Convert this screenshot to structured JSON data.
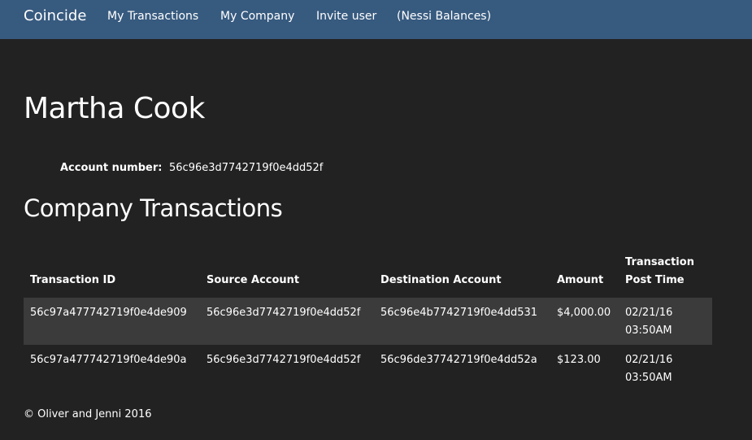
{
  "navbar": {
    "brand": "Coincide",
    "links": [
      "My Transactions",
      "My Company",
      "Invite user",
      "(Nessi Balances)"
    ]
  },
  "page": {
    "title": "Martha Cook",
    "account_label": "Account number:",
    "account_number": "56c96e3d7742719f0e4dd52f",
    "section_title": "Company Transactions"
  },
  "table": {
    "headers": [
      "Transaction ID",
      "Source Account",
      "Destination Account",
      "Amount",
      "Transaction Post Time"
    ],
    "rows": [
      {
        "transaction_id": "56c97a477742719f0e4de909",
        "source": "56c96e3d7742719f0e4dd52f",
        "destination": "56c96e4b7742719f0e4dd531",
        "amount": "$4,000.00",
        "post_time": "02/21/16 03:50AM"
      },
      {
        "transaction_id": "56c97a477742719f0e4de90a",
        "source": "56c96e3d7742719f0e4dd52f",
        "destination": "56c96de37742719f0e4dd52a",
        "amount": "$123.00",
        "post_time": "02/21/16 03:50AM"
      }
    ]
  },
  "footer": {
    "text": "© Oliver and Jenni 2016"
  },
  "colors": {
    "navbar": "#375a7f",
    "background": "#222222",
    "stripe": "#3b3b3b",
    "text": "#ffffff"
  }
}
